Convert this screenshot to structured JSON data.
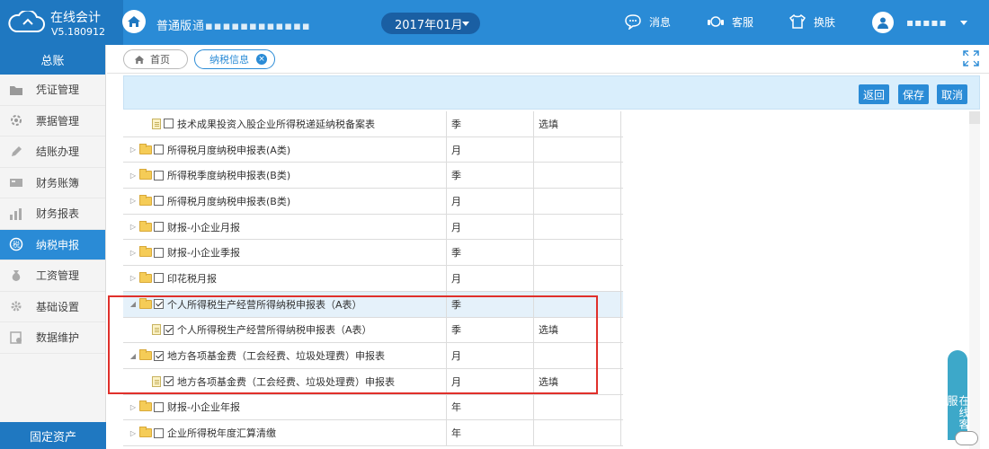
{
  "app": {
    "title": "在线会计",
    "version": "V5.180912",
    "edition": "普通版",
    "company": "通▪▪▪▪▪▪▪▪▪▪▪▪"
  },
  "period": {
    "value": "2017年01月"
  },
  "header_tools": [
    {
      "label": "消息",
      "icon": "message-icon"
    },
    {
      "label": "客服",
      "icon": "headset-icon"
    },
    {
      "label": "换肤",
      "icon": "shirt-icon"
    }
  ],
  "user": {
    "name": "▪▪▪▪▪"
  },
  "sidebar": {
    "header": "总账",
    "items": [
      {
        "label": "凭证管理",
        "icon": "folder-icon"
      },
      {
        "label": "票据管理",
        "icon": "ticket-icon"
      },
      {
        "label": "结账办理",
        "icon": "pencil-icon"
      },
      {
        "label": "财务账簿",
        "icon": "book-icon"
      },
      {
        "label": "财务报表",
        "icon": "chart-icon"
      },
      {
        "label": "纳税申报",
        "icon": "tax-icon"
      },
      {
        "label": "工资管理",
        "icon": "wage-icon"
      },
      {
        "label": "基础设置",
        "icon": "settings-icon"
      },
      {
        "label": "数据维护",
        "icon": "data-icon"
      }
    ],
    "active_index": 5,
    "footer": "固定资产"
  },
  "tabs": [
    {
      "label": "首页"
    },
    {
      "label": "纳税信息"
    }
  ],
  "actions": {
    "back": "返回",
    "save": "保存",
    "cancel": "取消"
  },
  "table_rows": [
    {
      "type": "doc",
      "checked": false,
      "name": "技术成果投资入股企业所得税递延纳税备案表",
      "period": "季",
      "req": "选填",
      "expanded": null
    },
    {
      "type": "folder",
      "checked": false,
      "name": "所得税月度纳税申报表(A类)",
      "period": "月",
      "req": "",
      "expanded": false
    },
    {
      "type": "folder",
      "checked": false,
      "name": "所得税季度纳税申报表(B类)",
      "period": "季",
      "req": "",
      "expanded": false
    },
    {
      "type": "folder",
      "checked": false,
      "name": "所得税月度纳税申报表(B类)",
      "period": "月",
      "req": "",
      "expanded": false
    },
    {
      "type": "folder",
      "checked": false,
      "name": "财报-小企业月报",
      "period": "月",
      "req": "",
      "expanded": false
    },
    {
      "type": "folder",
      "checked": false,
      "name": "财报-小企业季报",
      "period": "季",
      "req": "",
      "expanded": false
    },
    {
      "type": "folder",
      "checked": false,
      "name": "印花税月报",
      "period": "月",
      "req": "",
      "expanded": false
    },
    {
      "type": "folder",
      "checked": true,
      "name": "个人所得税生产经营所得纳税申报表（A表）",
      "period": "季",
      "req": "",
      "expanded": true
    },
    {
      "type": "doc",
      "checked": true,
      "name": "个人所得税生产经营所得纳税申报表（A表）",
      "period": "季",
      "req": "选填",
      "expanded": null
    },
    {
      "type": "folder",
      "checked": true,
      "name": "地方各项基金费（工会经费、垃圾处理费）申报表",
      "period": "月",
      "req": "",
      "expanded": true
    },
    {
      "type": "doc",
      "checked": true,
      "name": "地方各项基金费（工会经费、垃圾处理费）申报表",
      "period": "月",
      "req": "选填",
      "expanded": null
    },
    {
      "type": "folder",
      "checked": false,
      "name": "财报-小企业年报",
      "period": "年",
      "req": "",
      "expanded": false
    },
    {
      "type": "folder",
      "checked": false,
      "name": "企业所得税年度汇算清缴",
      "period": "年",
      "req": "",
      "expanded": false
    }
  ],
  "highlight_row_index": 7,
  "online_service": "在线客服"
}
